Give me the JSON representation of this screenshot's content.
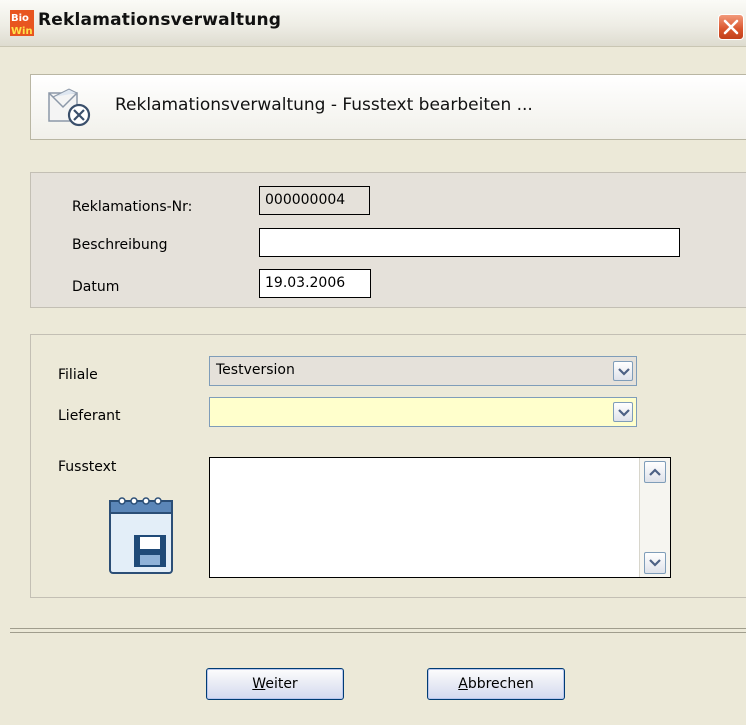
{
  "window": {
    "title": "Reklamationsverwaltung",
    "app_icon_text_top": "Bio",
    "app_icon_text_bottom": "Win"
  },
  "header": {
    "text": "Reklamationsverwaltung - Fusstext bearbeiten ..."
  },
  "info": {
    "reklamations_nr_label": "Reklamations-Nr:",
    "reklamations_nr_value": "000000004",
    "beschreibung_label": "Beschreibung",
    "beschreibung_value": "",
    "datum_label": "Datum",
    "datum_value": "19.03.2006"
  },
  "form": {
    "filiale_label": "Filiale",
    "filiale_value": "Testversion",
    "lieferant_label": "Lieferant",
    "lieferant_value": "",
    "fusstext_label": "Fusstext",
    "fusstext_value": ""
  },
  "buttons": {
    "weiter_mnemonic": "W",
    "weiter_rest": "eiter",
    "abbrechen_mnemonic": "A",
    "abbrechen_rest": "bbrechen"
  },
  "colors": {
    "lieferant_bg": "#FFFFCC",
    "filiale_bg": "#E5E1DA",
    "info_panel_bg": "#E5E1DA",
    "dialog_bg": "#ECE9D8",
    "close_button": "#D9542C"
  }
}
